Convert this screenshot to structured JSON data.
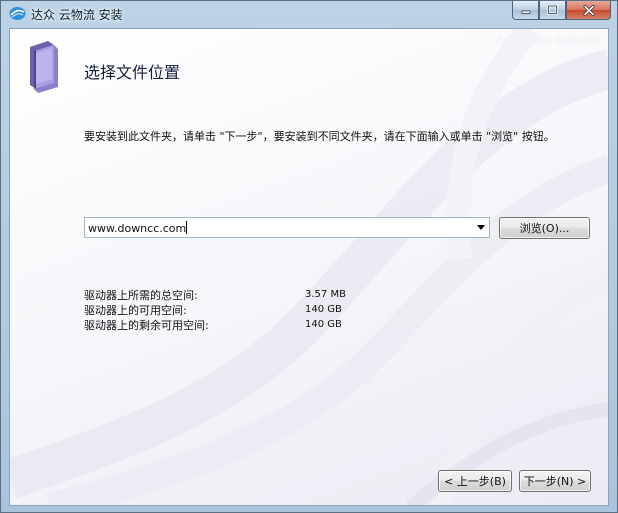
{
  "window": {
    "title": "达众 云物流 安装",
    "controls": {
      "minimize": "–",
      "maximize": "□",
      "close": "✕"
    }
  },
  "branding": {
    "watermark": "Advanced Installer"
  },
  "page": {
    "title": "选择文件位置",
    "instruction": "要安装到此文件夹，请单击 \"下一步\"，要安装到不同文件夹，请在下面输入或单击 \"浏览\" 按钮。"
  },
  "path": {
    "value": "www.downcc.com"
  },
  "buttons": {
    "browse": "浏览(O)...",
    "back": "< 上一步(B)",
    "next": "下一步(N) >"
  },
  "space": {
    "rows": [
      {
        "label": "驱动器上所需的总空间:",
        "value": "3.57 MB"
      },
      {
        "label": "驱动器上的可用空间:",
        "value": "140 GB"
      },
      {
        "label": "驱动器上的剩余可用空间:",
        "value": "140 GB"
      }
    ]
  },
  "icons": {
    "app": "app-logo-icon",
    "header": "folder-icon",
    "dropdown": "chevron-down-icon"
  }
}
